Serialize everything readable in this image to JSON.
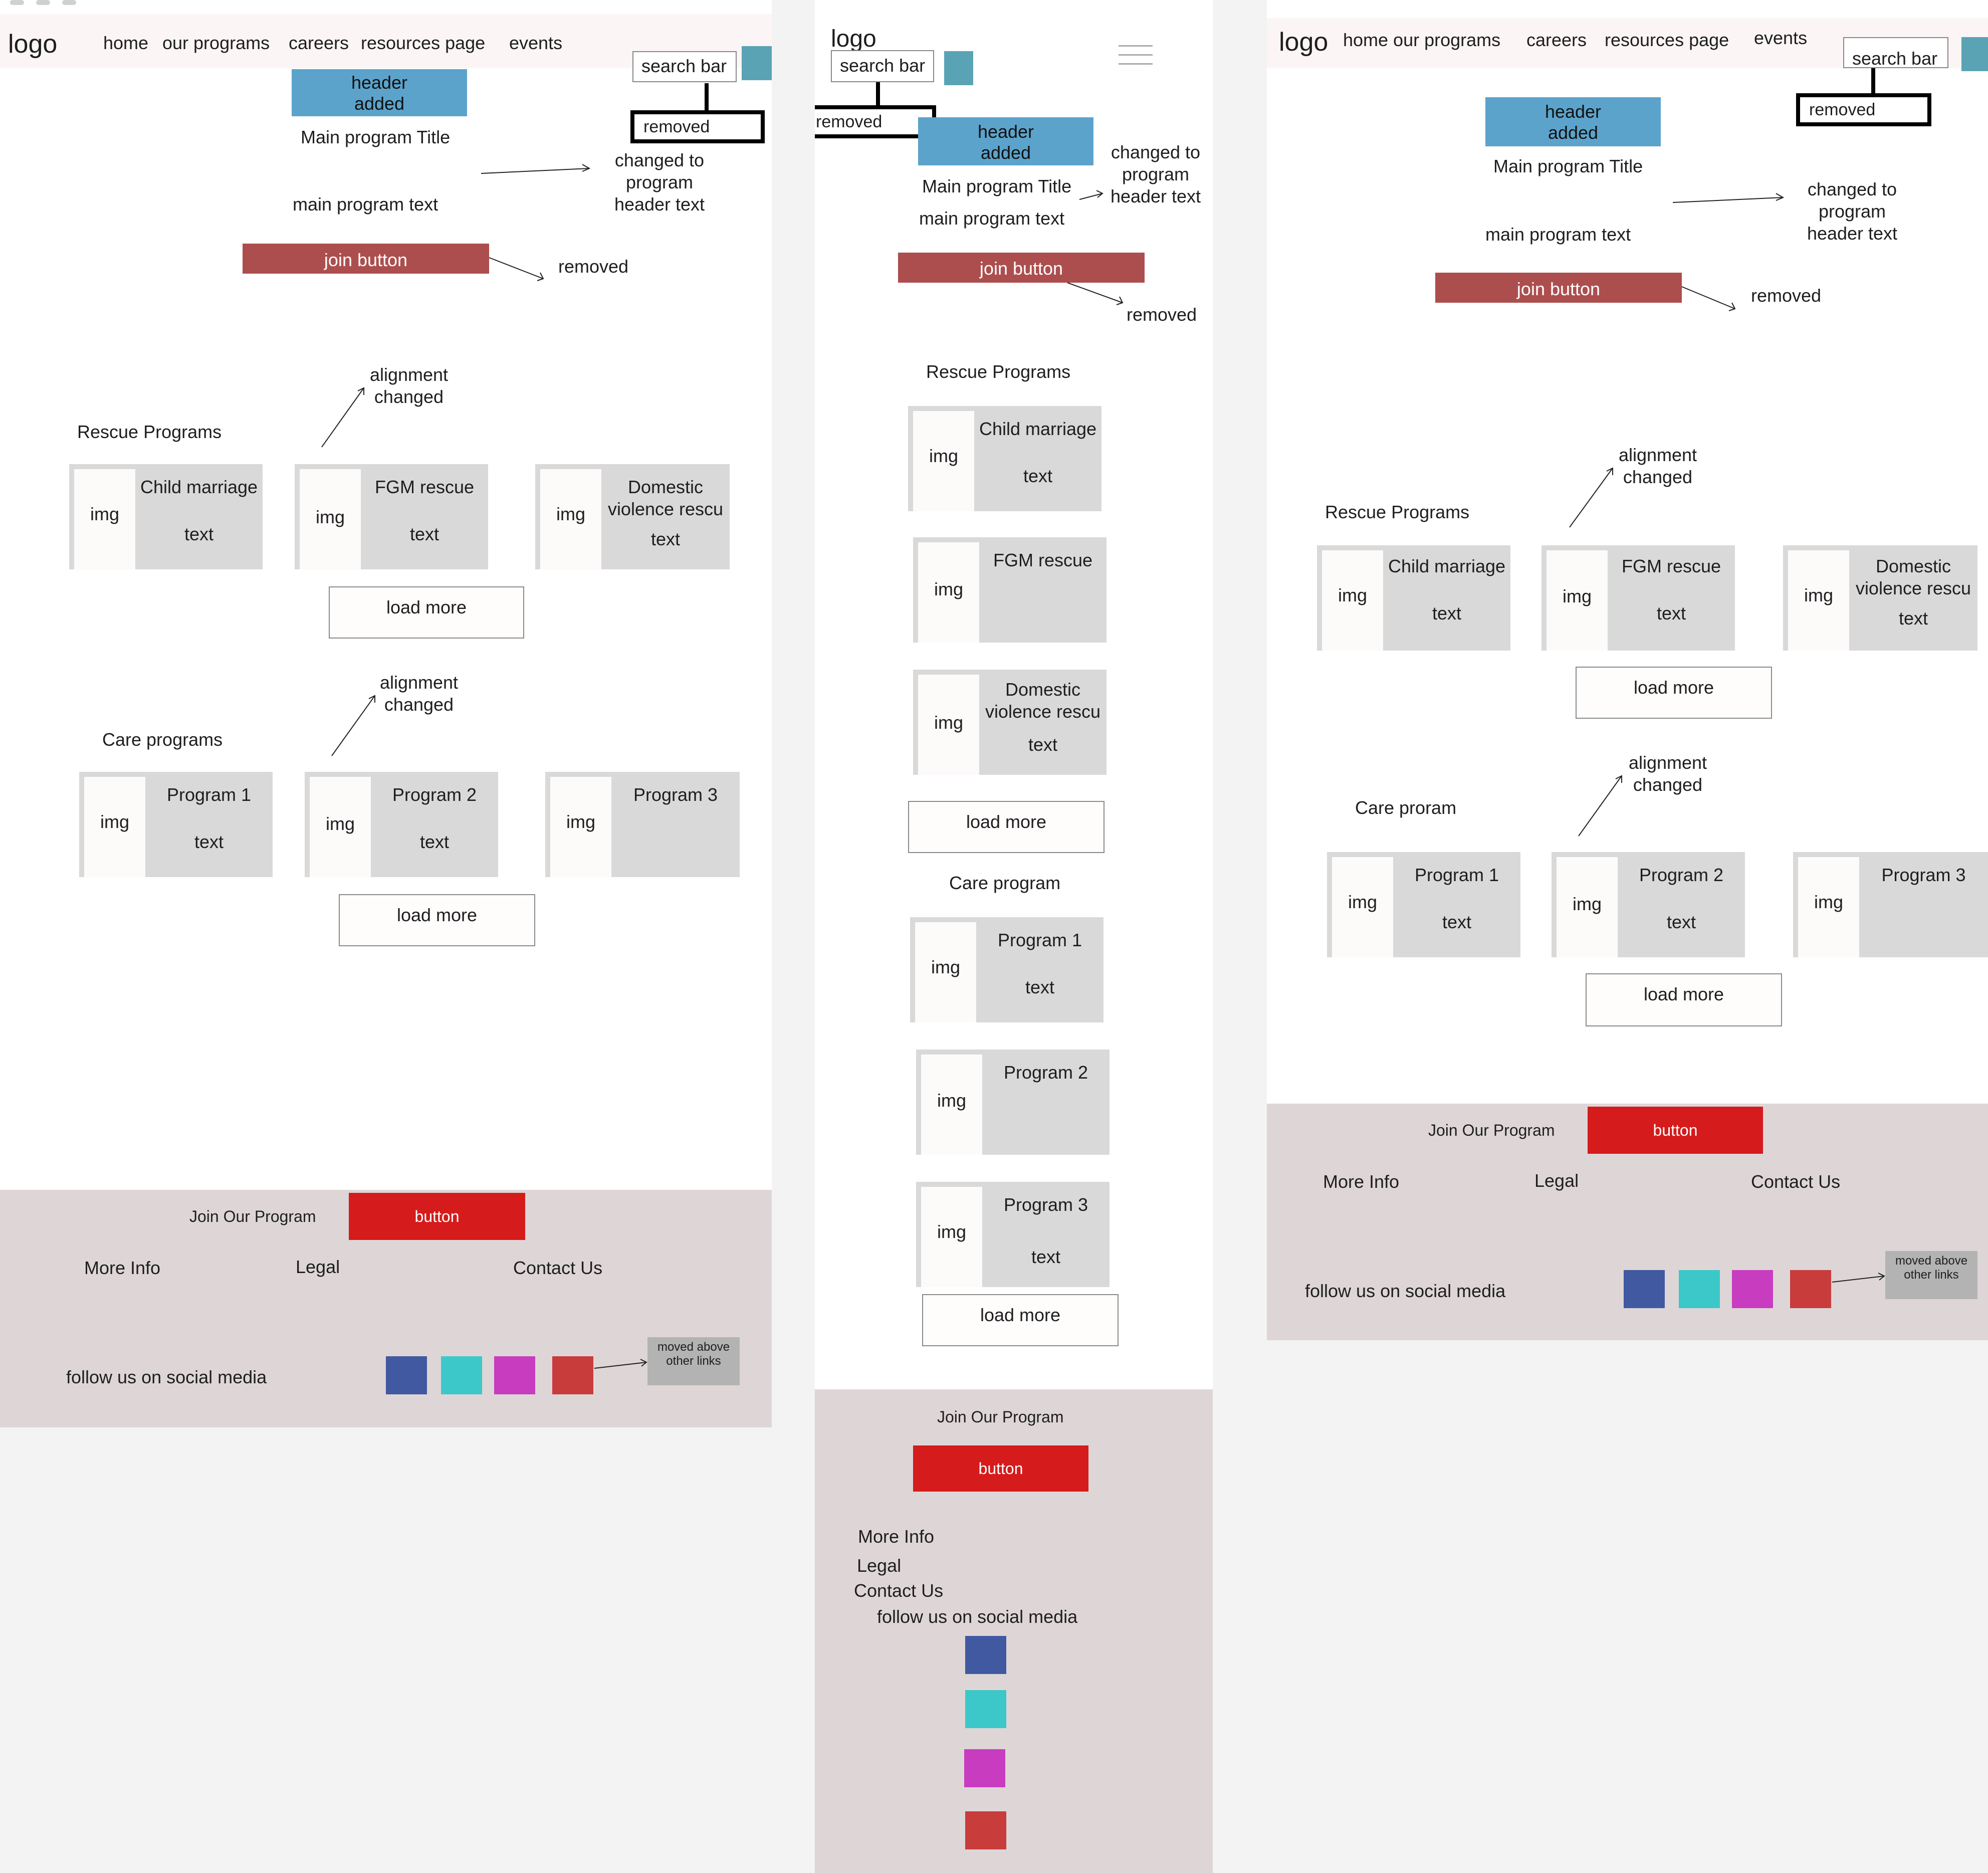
{
  "nav": {
    "logo": "logo",
    "home": "home",
    "our_programs": "our programs",
    "careers": "careers",
    "resources": "resources page",
    "events": "events",
    "home_our_programs": "home our programs"
  },
  "search": {
    "label": "search bar",
    "removed": "removed"
  },
  "hero": {
    "header_added": "header\nadded",
    "title": "Main program Title",
    "text": "main program text",
    "join_button": "join button",
    "changed_note": "changed to\nprogram\nheader text",
    "changed_note_mobile": "changed to\nprogram\nheader text",
    "removed_note": "removed"
  },
  "rescue": {
    "heading": "Rescue  Programs",
    "alignment_note": "alignment\nchanged",
    "cards": [
      {
        "img": "img",
        "title": "Child marriage",
        "text": "text"
      },
      {
        "img": "img",
        "title": "FGM rescue",
        "text": "text"
      },
      {
        "img": "img",
        "title": "Domestic\nviolence rescu",
        "text": "text"
      }
    ],
    "load_more": "load more"
  },
  "care": {
    "heading_desktop": "Care programs",
    "heading_mobile": "Care program",
    "heading_tablet": "Care proram",
    "alignment_note": "alignment\nchanged",
    "cards": [
      {
        "img": "img",
        "title": "Program 1",
        "text": "text"
      },
      {
        "img": "img",
        "title": "Program 2",
        "text": "text"
      },
      {
        "img": "img",
        "title": "Program 3",
        "text": ""
      }
    ],
    "mobile_cards": [
      {
        "img": "img",
        "title": "Program 1",
        "text": "text"
      },
      {
        "img": "img",
        "title": "Program 2",
        "text": ""
      },
      {
        "img": "img",
        "title": "Program 3",
        "text": "text"
      }
    ],
    "load_more": "load more"
  },
  "footer": {
    "join": "Join Our Program",
    "button": "button",
    "more_info": "More Info",
    "legal": "Legal",
    "contact": "Contact Us",
    "social": "follow us on social media",
    "moved_note": "moved above\nother links"
  },
  "colors": {
    "social": [
      "#4059a0",
      "#3cc8c8",
      "#c83cc0",
      "#c83c3c"
    ],
    "footer_button": "#d51b1b",
    "join_button": "#ad4e4e",
    "header_added": "#5ca3cc",
    "footer_bg": "#ded6d6"
  }
}
